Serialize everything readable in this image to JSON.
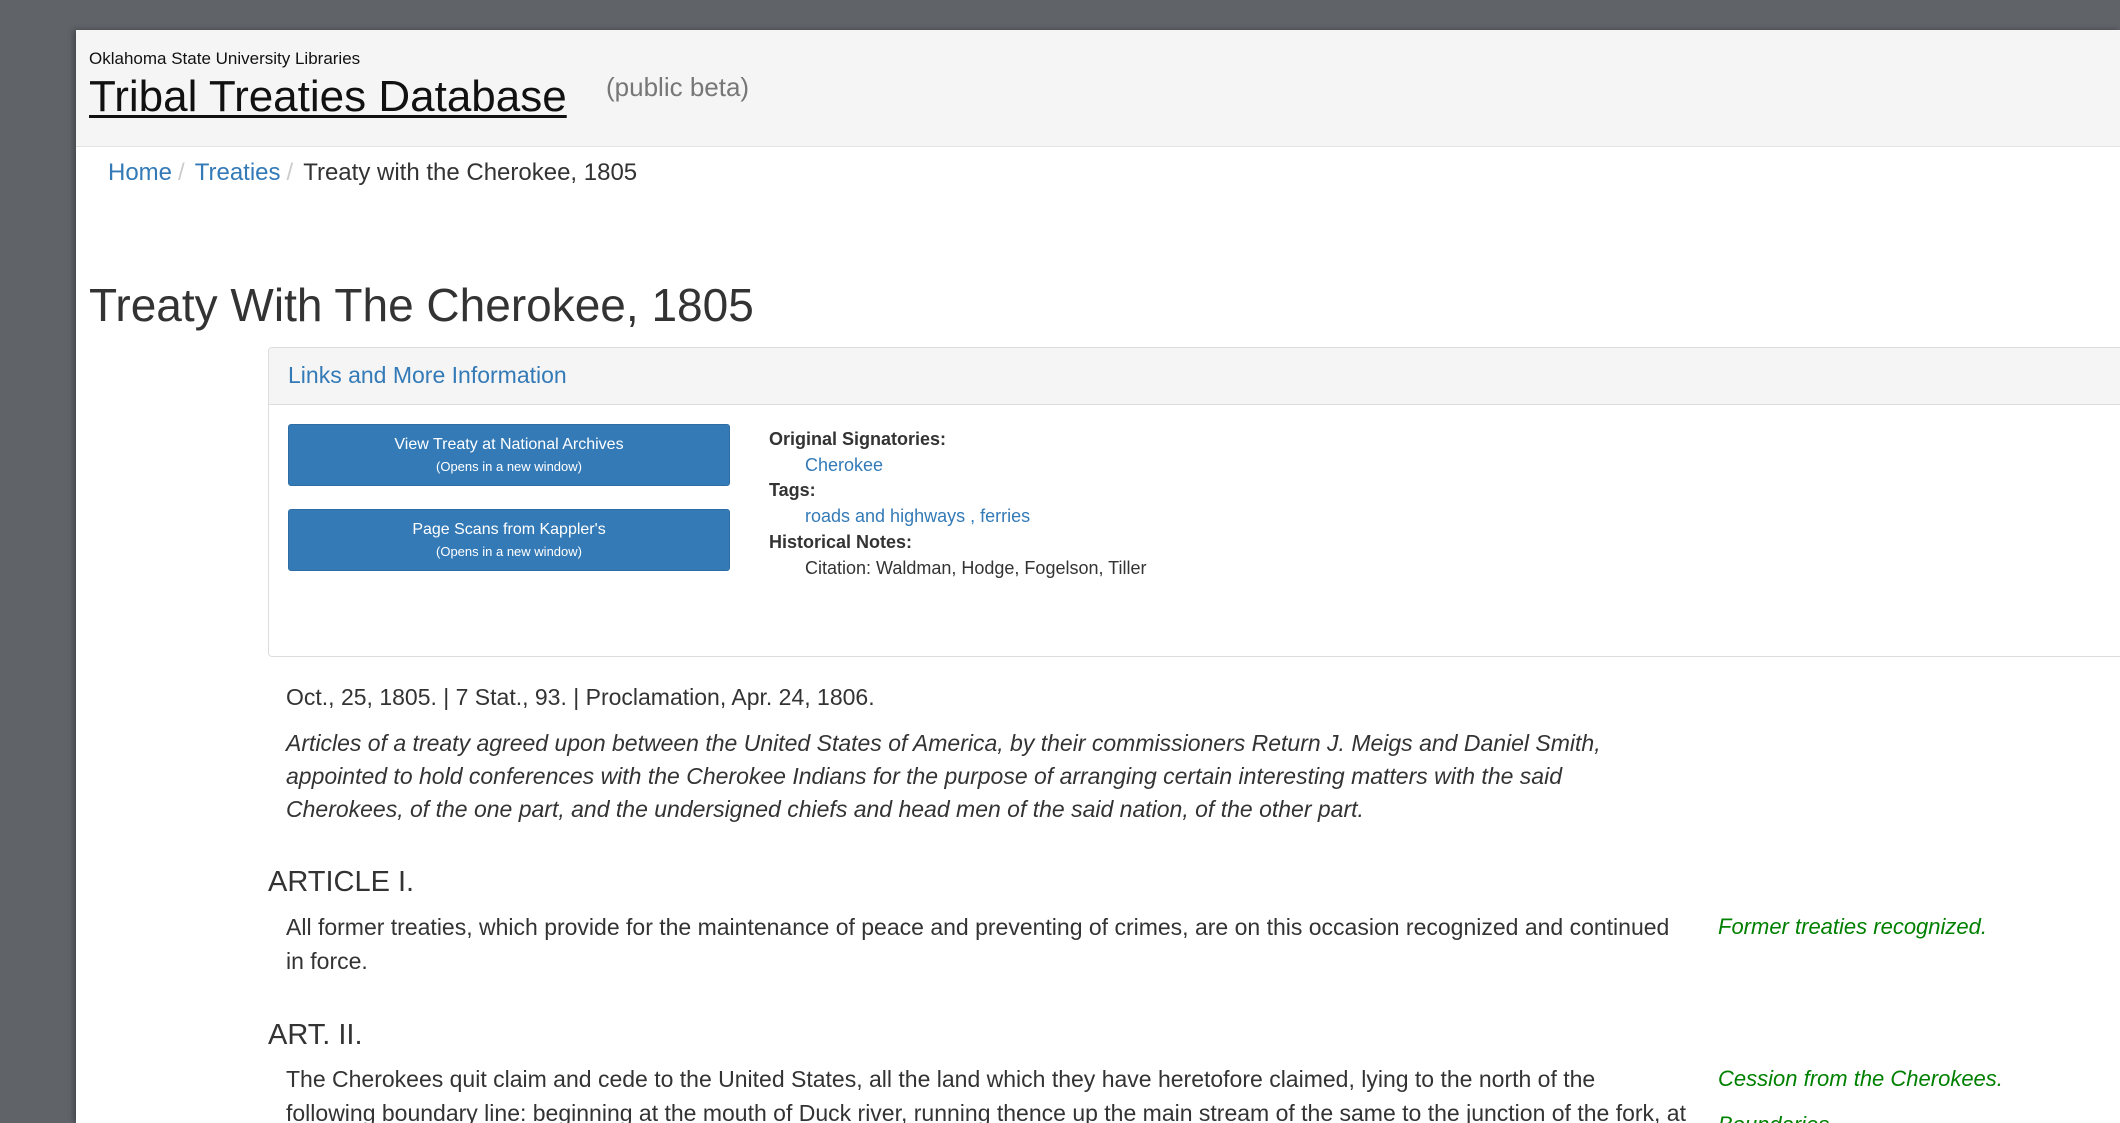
{
  "header": {
    "org": "Oklahoma State University Libraries",
    "site_title": "Tribal Treaties Database",
    "beta": "(public beta)"
  },
  "breadcrumb": {
    "items": [
      "Home",
      "Treaties"
    ],
    "current": "Treaty with the Cherokee, 1805",
    "separator": "/"
  },
  "page_title": "Treaty With The Cherokee, 1805",
  "panel": {
    "heading": "Links and More Information",
    "buttons": [
      {
        "label": "View Treaty at National Archives",
        "sub": "(Opens in a new window)"
      },
      {
        "label": "Page Scans from Kappler's",
        "sub": "(Opens in a new window)"
      }
    ],
    "signatories_label": "Original Signatories:",
    "signatories": "Cherokee",
    "tags_label": "Tags:",
    "tags": [
      "roads and highways",
      "ferries"
    ],
    "tags_separator": " , ",
    "notes_label": "Historical Notes:",
    "notes": "Citation: Waldman, Hodge, Fogelson, Tiller"
  },
  "treaty": {
    "date_line": "Oct., 25, 1805. | 7 Stat., 93. | Proclamation, Apr. 24, 1806.",
    "preamble": "Articles of a treaty agreed upon between the United States of America, by their commissioners Return J. Meigs and Daniel Smith, appointed to hold conferences with the Cherokee Indians for the purpose of arranging certain interesting matters with the said Cherokees, of the one part, and the undersigned chiefs and head men of the said nation, of the other part.",
    "articles": [
      {
        "heading": "ARTICLE I.",
        "text": "All former treaties, which provide for the maintenance of peace and preventing of crimes, are on this occasion recognized and continued in force.",
        "notes": [
          "Former treaties recognized."
        ]
      },
      {
        "heading": "ART. II.",
        "text": "The Cherokees quit claim and cede to the United States, all the land which they have heretofore claimed, lying to the north of the following boundary line: beginning at the mouth of Duck river, running thence up the main stream of the same to the junction of the fork, at the head of which fort Nash stood, with the main south fork; thence a direct course to a point on the Tennessee",
        "notes": [
          "Cession from the Cherokees.",
          "Boundaries."
        ]
      }
    ]
  },
  "colors": {
    "backdrop": "#606469",
    "link": "#337ab7",
    "button": "#337ab7",
    "margin_note": "#008000",
    "text": "#333333"
  }
}
